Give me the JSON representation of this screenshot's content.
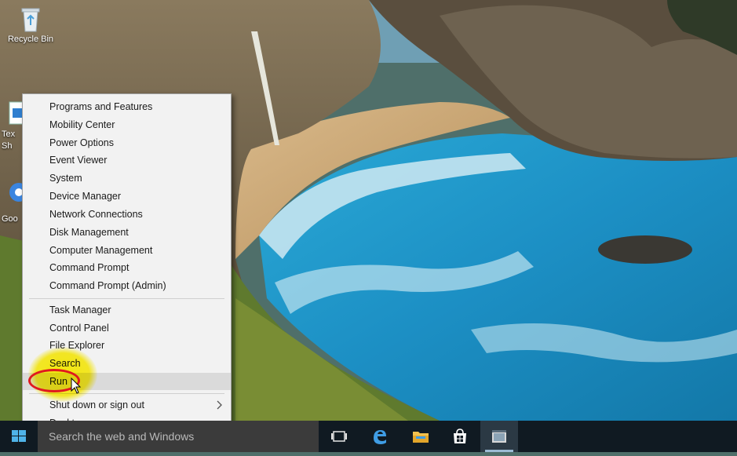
{
  "desktop": {
    "icons": [
      {
        "label": "Recycle Bin",
        "icon": "recycle-bin-icon"
      }
    ],
    "partial_labels": [
      "Tex",
      "Sh",
      "Goo"
    ]
  },
  "context_menu": {
    "group1": [
      "Programs and Features",
      "Mobility Center",
      "Power Options",
      "Event Viewer",
      "System",
      "Device Manager",
      "Network Connections",
      "Disk Management",
      "Computer Management",
      "Command Prompt",
      "Command Prompt (Admin)"
    ],
    "group2": [
      "Task Manager",
      "Control Panel",
      "File Explorer",
      "Search",
      "Run"
    ],
    "group3": [
      "Shut down or sign out",
      "Desktop"
    ],
    "hovered_item": "Run"
  },
  "taskbar": {
    "search_placeholder": "Search the web and Windows",
    "icons": [
      "task-view-icon",
      "edge-icon",
      "file-explorer-icon",
      "store-icon",
      "app-icon"
    ]
  },
  "colors": {
    "menu_bg": "#f2f2f2",
    "menu_hover": "#dadada",
    "taskbar_bg": "#101a22",
    "annotation_red": "#e0191f",
    "annotation_yellow": "#fff500"
  }
}
